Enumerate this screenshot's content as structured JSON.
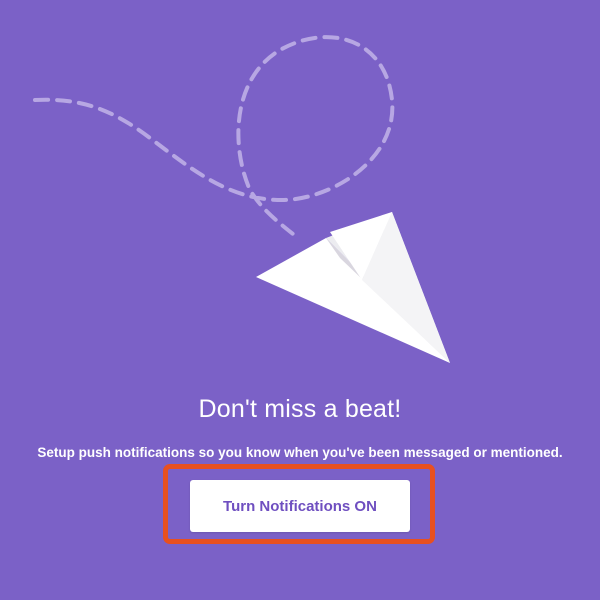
{
  "onboarding": {
    "headline": "Don't miss a beat!",
    "subtext": "Setup push notifications so you know when you've been messaged or mentioned.",
    "cta_label": "Turn Notifications ON"
  },
  "theme": {
    "background": "#7b61c7",
    "button_text_color": "#6f4fc0",
    "highlight_color": "#e8501f"
  },
  "illustration": {
    "icon": "paper-plane-icon",
    "trail": "dashed-flight-path"
  }
}
